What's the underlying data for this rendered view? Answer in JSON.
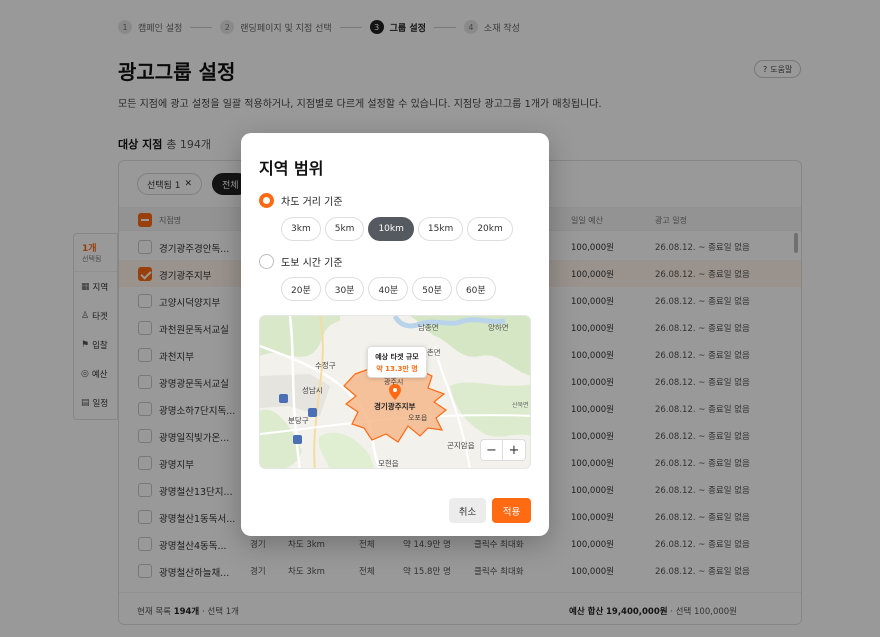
{
  "stepper": [
    {
      "num": "1",
      "label": "캠페인 설정"
    },
    {
      "num": "2",
      "label": "랜딩페이지 및 지점 선택"
    },
    {
      "num": "3",
      "label": "그룹 설정"
    },
    {
      "num": "4",
      "label": "소재 작성"
    }
  ],
  "page": {
    "title": "광고그룹 설정",
    "help": "도움말",
    "description": "모든 지점에 광고 설정을 일괄 적용하거나, 지점별로 다르게 설정할 수 있습니다. 지점당 광고그룹 1개가 매칭됩니다."
  },
  "section": {
    "title": "대상 지점",
    "count": "총 194개"
  },
  "filters": {
    "selected": "선택됨 1",
    "all": "전체"
  },
  "table": {
    "headers": {
      "name": "지점명",
      "budget": "일일 예산",
      "schedule": "광고 일정"
    },
    "rows": [
      {
        "name": "경기광주경안독...",
        "budget": "100,000원",
        "date": "26.08.12. ~ 종료일 없음"
      },
      {
        "name": "경기광주지부",
        "budget": "100,000원",
        "date": "26.08.12. ~ 종료일 없음"
      },
      {
        "name": "고양시덕양지부",
        "budget": "100,000원",
        "date": "26.08.12. ~ 종료일 없음"
      },
      {
        "name": "과천원문독서교실",
        "budget": "100,000원",
        "date": "26.08.12. ~ 종료일 없음"
      },
      {
        "name": "과천지부",
        "budget": "100,000원",
        "date": "26.08.12. ~ 종료일 없음"
      },
      {
        "name": "광명광문독서교실",
        "budget": "100,000원",
        "date": "26.08.12. ~ 종료일 없음"
      },
      {
        "name": "광명소하7단지독...",
        "budget": "100,000원",
        "date": "26.08.12. ~ 종료일 없음"
      },
      {
        "name": "광명일직빛가온...",
        "budget": "100,000원",
        "date": "26.08.12. ~ 종료일 없음"
      },
      {
        "name": "광명지부",
        "budget": "100,000원",
        "date": "26.08.12. ~ 종료일 없음"
      },
      {
        "name": "광명철산13단지...",
        "budget": "100,000원",
        "date": "26.08.12. ~ 종료일 없음"
      },
      {
        "name": "광명철산1동독서...",
        "budget": "100,000원",
        "date": "26.08.12. ~ 종료일 없음"
      },
      {
        "name": "광명철산4동독...",
        "region": "경기",
        "distance": "차도 3km",
        "target": "전체",
        "size": "약 14.9만 명",
        "strategy": "클릭수 최대화",
        "budget": "100,000원",
        "date": "26.08.12. ~ 종료일 없음"
      },
      {
        "name": "광명철산하늘채...",
        "region": "경기",
        "distance": "차도 3km",
        "target": "전체",
        "size": "약 15.8만 명",
        "strategy": "클릭수 최대화",
        "budget": "100,000원",
        "date": "26.08.12. ~ 종료일 없음"
      }
    ]
  },
  "footer": {
    "list_label": "현재 목록",
    "list_count": "194개",
    "list_sel": "· 선택 1개",
    "budget_label": "예산 합산",
    "budget_total": "19,400,000원",
    "budget_sel": "· 선택 100,000원"
  },
  "side_nav": {
    "count": "1개",
    "count_sub": "선택됨",
    "items": [
      {
        "icon": "map-icon",
        "glyph": "▦",
        "label": "지역"
      },
      {
        "icon": "target-icon",
        "glyph": "♙",
        "label": "타겟"
      },
      {
        "icon": "flag-icon",
        "glyph": "⚑",
        "label": "입찰"
      },
      {
        "icon": "budget-icon",
        "glyph": "◎",
        "label": "예산"
      },
      {
        "icon": "calendar-icon",
        "glyph": "▤",
        "label": "일정"
      }
    ]
  },
  "modal": {
    "title": "지역 범위",
    "road": {
      "label": "차도 거리 기준",
      "options": [
        "3km",
        "5km",
        "10km",
        "15km",
        "20km"
      ],
      "selected": "10km"
    },
    "walk": {
      "label": "도보 시간 기준",
      "options": [
        "20분",
        "30분",
        "40분",
        "50분",
        "60분"
      ]
    },
    "map": {
      "tooltip_title": "예상 타겟 규모",
      "tooltip_value": "약 13.3만 명",
      "center_label": "경기광주지부",
      "places": [
        "남종면",
        "양하면",
        "퇴촌면",
        "수정구",
        "성남시",
        "광주시",
        "분당구",
        "오포읍",
        "곤지암읍",
        "모현읍",
        "산북면"
      ],
      "zoom_out": "−",
      "zoom_in": "+"
    },
    "cancel": "취소",
    "apply": "적용",
    "colors": {
      "accent": "#ff6a13",
      "radius_fill": "#f6b88c"
    }
  }
}
